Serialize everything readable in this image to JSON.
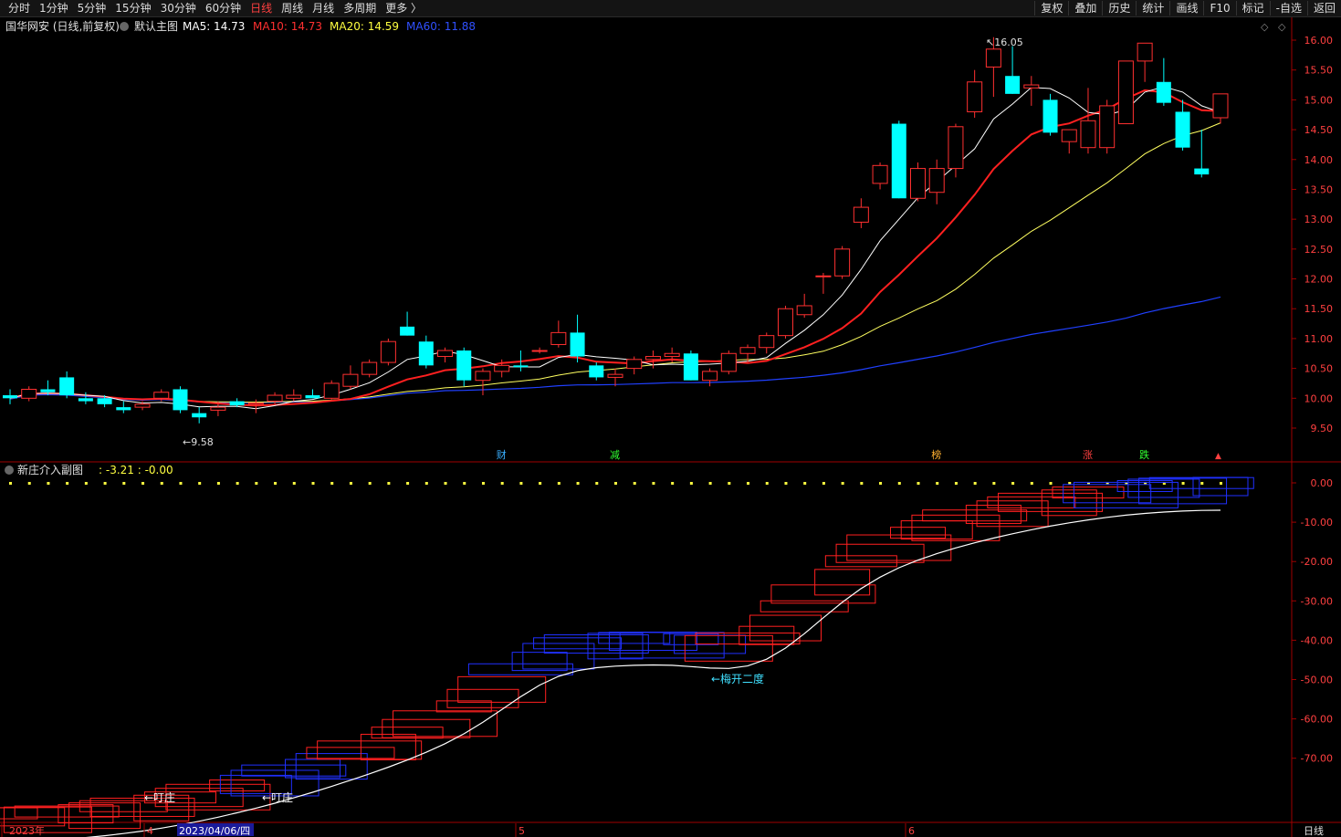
{
  "toolbar": {
    "periods": [
      "分时",
      "1分钟",
      "5分钟",
      "15分钟",
      "30分钟",
      "60分钟",
      "日线",
      "周线",
      "月线",
      "多周期",
      "更多 〉"
    ],
    "active_period": "日线",
    "tools": [
      "复权",
      "叠加",
      "历史",
      "统计",
      "画线",
      "F10",
      "标记",
      "-自选",
      "返回"
    ]
  },
  "main_panel": {
    "stock": "国华网安 (日线,前复权)",
    "template": "默认主图",
    "ma": [
      {
        "label": "MA5:",
        "value": "14.73",
        "color": "#ffffff"
      },
      {
        "label": "MA10:",
        "value": "14.73",
        "color": "#ff3030"
      },
      {
        "label": "MA20:",
        "value": "14.59",
        "color": "#ffff40"
      },
      {
        "label": "MA60:",
        "value": "11.88",
        "color": "#3050ff"
      }
    ],
    "y_ticks": [
      "16.00",
      "15.50",
      "15.00",
      "14.50",
      "14.00",
      "13.50",
      "13.00",
      "12.50",
      "12.00",
      "11.50",
      "11.00",
      "10.50",
      "10.00",
      "9.50"
    ],
    "high_label": "16.05",
    "low_label": "9.58",
    "event_markers": [
      {
        "text": "财",
        "color": "#3ab0ff",
        "idx": 26
      },
      {
        "text": "减",
        "color": "#30ff30",
        "idx": 32
      },
      {
        "text": "榜",
        "color": "#ffb030",
        "idx": 49
      },
      {
        "text": "涨",
        "color": "#ff4040",
        "idx": 57
      },
      {
        "text": "跌",
        "color": "#30ff30",
        "idx": 60
      }
    ]
  },
  "sub_panel": {
    "title": "新庄介入副图",
    "values": ": -3.21 : -0.00",
    "y_ticks": [
      "0.00",
      "-10.00",
      "-20.00",
      "-30.00",
      "-40.00",
      "-50.00",
      "-60.00",
      "-70.00"
    ],
    "annotations": [
      {
        "text": "←叮庄",
        "color": "#ffffff"
      },
      {
        "text": "←叮庄",
        "color": "#ffffff"
      },
      {
        "text": "←梅开二度",
        "color": "#40e0ff"
      }
    ]
  },
  "date_axis": {
    "labels": [
      "2023年",
      "4",
      "2023/04/06/四",
      "5",
      "6"
    ],
    "period_button": "日线"
  },
  "chart_data": {
    "type": "candlestick",
    "colors": {
      "up": "#ff3030",
      "down": "#00ffff",
      "ma5": "#ffffff",
      "ma10": "#ff2020",
      "ma20": "#ffff60",
      "ma60": "#2040ff"
    },
    "ylim": [
      9.3,
      16.25
    ],
    "candles": [
      [
        10.05,
        10.15,
        9.9,
        10.0
      ],
      [
        10.0,
        10.2,
        9.95,
        10.15
      ],
      [
        10.15,
        10.3,
        10.05,
        10.1
      ],
      [
        10.35,
        10.45,
        10.0,
        10.05
      ],
      [
        10.0,
        10.1,
        9.9,
        9.95
      ],
      [
        10.0,
        10.05,
        9.85,
        9.9
      ],
      [
        9.85,
        9.95,
        9.75,
        9.8
      ],
      [
        9.85,
        9.95,
        9.8,
        9.9
      ],
      [
        10.0,
        10.15,
        9.95,
        10.1
      ],
      [
        10.15,
        10.2,
        9.75,
        9.8
      ],
      [
        9.75,
        9.85,
        9.58,
        9.68
      ],
      [
        9.8,
        9.95,
        9.7,
        9.85
      ],
      [
        9.95,
        10.0,
        9.85,
        9.88
      ],
      [
        9.9,
        9.98,
        9.75,
        9.92
      ],
      [
        9.95,
        10.1,
        9.9,
        10.05
      ],
      [
        10.0,
        10.15,
        9.95,
        10.05
      ],
      [
        10.05,
        10.15,
        10.0,
        10.0
      ],
      [
        10.0,
        10.3,
        9.98,
        10.25
      ],
      [
        10.2,
        10.55,
        10.15,
        10.4
      ],
      [
        10.4,
        10.65,
        10.35,
        10.6
      ],
      [
        10.6,
        11.0,
        10.55,
        10.95
      ],
      [
        11.2,
        11.45,
        11.05,
        11.05
      ],
      [
        10.95,
        11.05,
        10.5,
        10.55
      ],
      [
        10.7,
        10.85,
        10.6,
        10.8
      ],
      [
        10.8,
        10.85,
        10.2,
        10.3
      ],
      [
        10.3,
        10.5,
        10.05,
        10.45
      ],
      [
        10.45,
        10.65,
        10.35,
        10.55
      ],
      [
        10.55,
        10.8,
        10.45,
        10.52
      ],
      [
        10.8,
        10.85,
        10.75,
        10.8
      ],
      [
        10.9,
        11.3,
        10.85,
        11.1
      ],
      [
        11.1,
        11.4,
        10.6,
        10.7
      ],
      [
        10.55,
        10.6,
        10.3,
        10.35
      ],
      [
        10.35,
        10.5,
        10.2,
        10.4
      ],
      [
        10.5,
        10.7,
        10.4,
        10.65
      ],
      [
        10.65,
        10.8,
        10.5,
        10.7
      ],
      [
        10.7,
        10.85,
        10.6,
        10.75
      ],
      [
        10.75,
        10.8,
        10.3,
        10.3
      ],
      [
        10.3,
        10.5,
        10.2,
        10.45
      ],
      [
        10.45,
        10.8,
        10.4,
        10.75
      ],
      [
        10.75,
        10.9,
        10.6,
        10.85
      ],
      [
        10.85,
        11.1,
        10.75,
        11.05
      ],
      [
        11.05,
        11.55,
        11.0,
        11.5
      ],
      [
        11.4,
        11.75,
        11.35,
        11.55
      ],
      [
        12.05,
        12.1,
        11.75,
        12.05
      ],
      [
        12.05,
        12.55,
        12.0,
        12.5
      ],
      [
        12.95,
        13.35,
        12.85,
        13.2
      ],
      [
        13.6,
        13.95,
        13.5,
        13.9
      ],
      [
        14.6,
        14.65,
        13.35,
        13.35
      ],
      [
        13.35,
        13.95,
        13.3,
        13.85
      ],
      [
        13.45,
        14.0,
        13.25,
        13.85
      ],
      [
        13.85,
        14.6,
        13.7,
        14.55
      ],
      [
        14.8,
        15.5,
        14.7,
        15.3
      ],
      [
        15.55,
        16.05,
        15.05,
        15.85
      ],
      [
        15.4,
        15.9,
        15.1,
        15.1
      ],
      [
        15.2,
        15.4,
        14.9,
        15.25
      ],
      [
        15.0,
        15.1,
        14.4,
        14.45
      ],
      [
        14.3,
        14.45,
        14.1,
        14.5
      ],
      [
        14.2,
        15.2,
        14.1,
        14.65
      ],
      [
        14.2,
        15.0,
        14.1,
        14.9
      ],
      [
        14.6,
        15.5,
        14.6,
        15.65
      ],
      [
        15.65,
        15.7,
        15.3,
        15.95
      ],
      [
        15.3,
        15.7,
        14.9,
        14.95
      ],
      [
        14.8,
        15.0,
        14.15,
        14.2
      ],
      [
        13.85,
        14.5,
        13.7,
        13.75
      ],
      [
        14.7,
        14.9,
        14.6,
        15.1
      ]
    ]
  }
}
